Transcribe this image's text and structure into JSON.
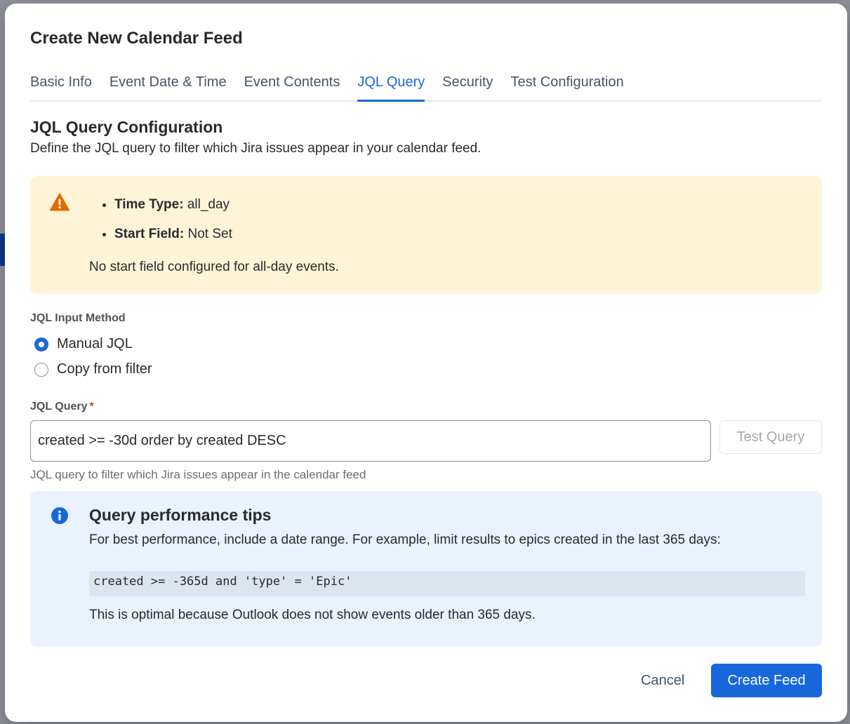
{
  "modal": {
    "title": "Create New Calendar Feed"
  },
  "tabs": [
    {
      "label": "Basic Info",
      "active": false
    },
    {
      "label": "Event Date & Time",
      "active": false
    },
    {
      "label": "Event Contents",
      "active": false
    },
    {
      "label": "JQL Query",
      "active": true
    },
    {
      "label": "Security",
      "active": false
    },
    {
      "label": "Test Configuration",
      "active": false
    }
  ],
  "section": {
    "title": "JQL Query Configuration",
    "description": "Define the JQL query to filter which Jira issues appear in your calendar feed."
  },
  "warning": {
    "icon": "warning-triangle-icon",
    "items": [
      {
        "key": "Time Type:",
        "value": "all_day"
      },
      {
        "key": "Start Field:",
        "value": "Not Set"
      }
    ],
    "note": "No start field configured for all-day events."
  },
  "input_method": {
    "label": "JQL Input Method",
    "options": [
      {
        "label": "Manual JQL",
        "checked": true
      },
      {
        "label": "Copy from filter",
        "checked": false
      }
    ]
  },
  "jql": {
    "label": "JQL Query",
    "required_mark": "*",
    "value": "created >= -30d order by created DESC",
    "test_button": "Test Query",
    "helper": "JQL query to filter which Jira issues appear in the calendar feed"
  },
  "tips": {
    "icon": "info-icon",
    "title": "Query performance tips",
    "text": "For best performance, include a date range. For example, limit results to epics created in the last 365 days:",
    "code": "created >= -365d and 'type' = 'Epic'",
    "note": "This is optimal because Outlook does not show events older than 365 days."
  },
  "footer": {
    "cancel_label": "Cancel",
    "create_label": "Create Feed"
  },
  "colors": {
    "accent": "#1868db",
    "warning_bg": "#fff4d8",
    "warning_icon": "#e06c00",
    "info_bg": "#e9f2fe",
    "required": "#c9372c"
  }
}
